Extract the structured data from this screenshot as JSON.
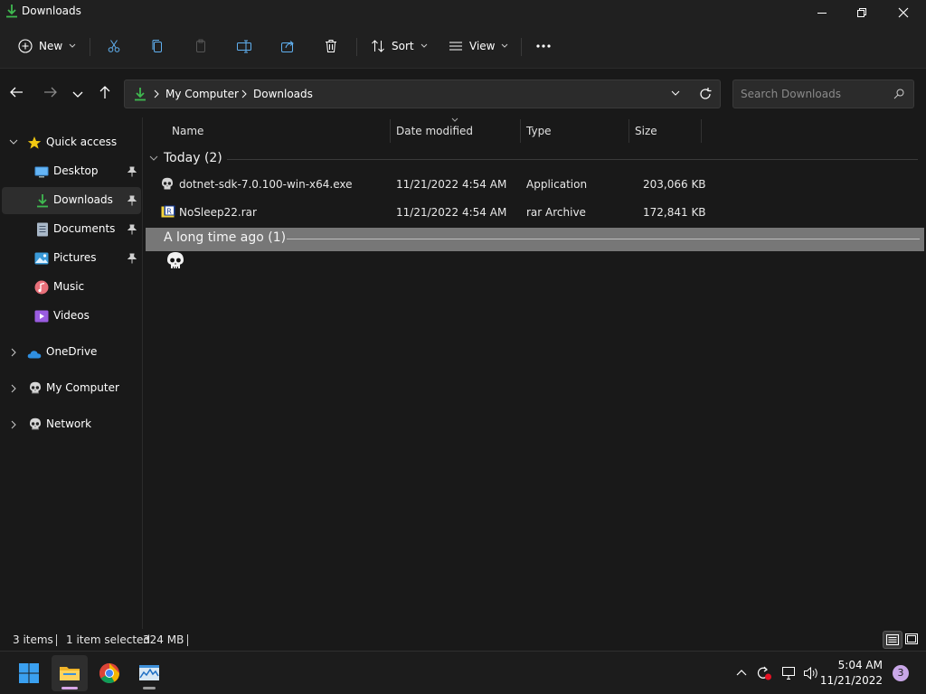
{
  "window": {
    "title": "Downloads",
    "controls": {
      "minimize": "minimize",
      "maximize": "restore",
      "close": "close"
    }
  },
  "commandbar": {
    "new_label": "New",
    "sort_label": "Sort",
    "view_label": "View",
    "icons": [
      "plus-circle-icon",
      "cut-icon",
      "copy-icon",
      "paste-icon",
      "rename-icon",
      "share-icon",
      "delete-icon",
      "sort-icon",
      "view-icon",
      "more-icon"
    ]
  },
  "address": {
    "breadcrumb": [
      "My Computer",
      "Downloads"
    ],
    "search_placeholder": "Search Downloads"
  },
  "sidebar": {
    "quick_access": "Quick access",
    "items": [
      {
        "label": "Desktop",
        "icon": "desktop-icon",
        "pinned": true
      },
      {
        "label": "Downloads",
        "icon": "download-icon",
        "pinned": true,
        "selected": true
      },
      {
        "label": "Documents",
        "icon": "documents-icon",
        "pinned": true
      },
      {
        "label": "Pictures",
        "icon": "pictures-icon",
        "pinned": true
      },
      {
        "label": "Music",
        "icon": "music-icon",
        "pinned": false
      },
      {
        "label": "Videos",
        "icon": "videos-icon",
        "pinned": false
      }
    ],
    "roots": [
      {
        "label": "OneDrive",
        "icon": "cloud-icon"
      },
      {
        "label": "My Computer",
        "icon": "skull-icon"
      },
      {
        "label": "Network",
        "icon": "skull-icon"
      }
    ]
  },
  "columns": {
    "name": "Name",
    "date": "Date modified",
    "type": "Type",
    "size": "Size"
  },
  "groups": [
    {
      "title": "Today (2)",
      "files": [
        {
          "name": "dotnet-sdk-7.0.100-win-x64.exe",
          "date": "11/21/2022 4:54 AM",
          "type": "Application",
          "size": "203,066 KB",
          "icon": "skull-icon"
        },
        {
          "name": "NoSleep22.rar",
          "date": "11/21/2022 4:54 AM",
          "type": "rar Archive",
          "size": "172,841 KB",
          "icon": "rar-icon"
        }
      ]
    },
    {
      "title": "A long time ago (1)",
      "selected": true
    }
  ],
  "status": {
    "count": "3 items",
    "selection": "1 item selected",
    "selection_size": "324 MB"
  },
  "taskbar": {
    "apps": [
      "windows-start-icon",
      "file-explorer-icon",
      "chrome-icon",
      "task-manager-icon"
    ],
    "time": "5:04 AM",
    "date": "11/21/2022",
    "notifications": "3",
    "colors": {
      "accent": "#c9a7e8",
      "selection": "#777777",
      "background": "#191919"
    }
  }
}
